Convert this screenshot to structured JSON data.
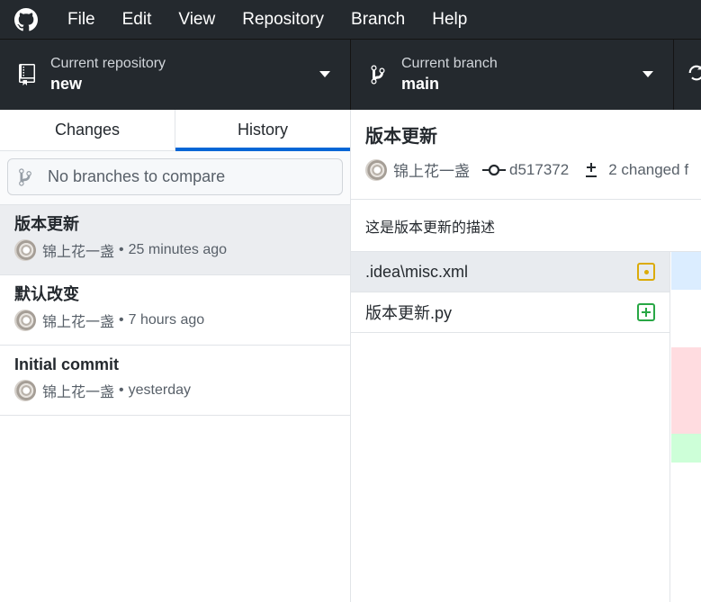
{
  "menubar": {
    "items": [
      "File",
      "Edit",
      "View",
      "Repository",
      "Branch",
      "Help"
    ]
  },
  "toolbar": {
    "repo_label": "Current repository",
    "repo_value": "new",
    "branch_label": "Current branch",
    "branch_value": "main"
  },
  "sidebar": {
    "tabs": [
      "Changes",
      "History"
    ],
    "active_tab": "History",
    "compare_placeholder": "No branches to compare",
    "commits": [
      {
        "title": "版本更新",
        "author": "锦上花一盏",
        "sep": "•",
        "time": "25 minutes ago"
      },
      {
        "title": "默认改变",
        "author": "锦上花一盏",
        "sep": "•",
        "time": "7 hours ago"
      },
      {
        "title": "Initial commit",
        "author": "锦上花一盏",
        "sep": "•",
        "time": "yesterday"
      }
    ]
  },
  "detail": {
    "title": "版本更新",
    "author": "锦上花一盏",
    "sha": "d517372",
    "changed": "2 changed f",
    "description": "这是版本更新的描述",
    "files": [
      {
        "name": ".idea\\misc.xml",
        "status": "modified"
      },
      {
        "name": "版本更新.py",
        "status": "added"
      }
    ]
  },
  "colors": {
    "chrome": "#24292e",
    "accent": "#0366d6",
    "modified": "#dbab09",
    "added": "#28a745"
  }
}
